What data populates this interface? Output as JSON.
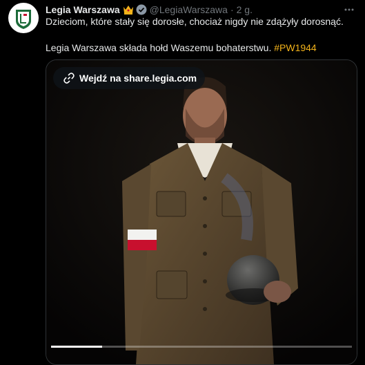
{
  "tweet": {
    "author_name": "Legia Warszawa",
    "handle": "@LegiaWarszawa",
    "separator": "·",
    "time": "2 g.",
    "line1": "Dzieciom, które stały się dorosłe, chociaż nigdy nie zdążyły dorosnąć.",
    "line2": "Legia Warszawa składa hołd Waszemu bohaterstwu.",
    "hashtag": "#PW1944",
    "icons": {
      "avatar": "legia-crest-icon",
      "crown": "crown-icon",
      "verified": "verified-badge-icon",
      "more": "more-icon",
      "link": "link-icon"
    }
  },
  "media": {
    "link_label": "Wejdź na share.legia.com",
    "video_progress": 0.17
  },
  "colors": {
    "hashtag": "#f3b31a",
    "secondary_text": "#71767b",
    "background": "#000000"
  }
}
